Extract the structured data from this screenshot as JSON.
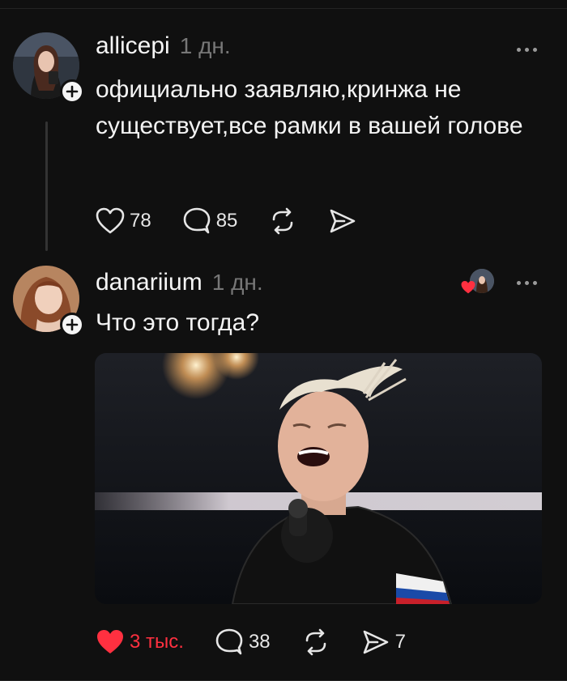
{
  "post1": {
    "username": "allicepi",
    "time": "1 дн.",
    "text": "официально заявляю,кринжа не существует,все рамки в вашей голове",
    "likes": "78",
    "comments": "85",
    "avatar_icon": "user-avatar",
    "liked": false
  },
  "post2": {
    "username": "danariium",
    "time": "1 дн.",
    "text": "Что это тогда?",
    "likes": "3 тыс.",
    "comments": "38",
    "shares": "7",
    "liked": true,
    "like_color": "#ff3040",
    "image_icon": "concert-photo"
  },
  "colors": {
    "background": "#101010",
    "muted": "#777777",
    "like": "#ff3040"
  }
}
